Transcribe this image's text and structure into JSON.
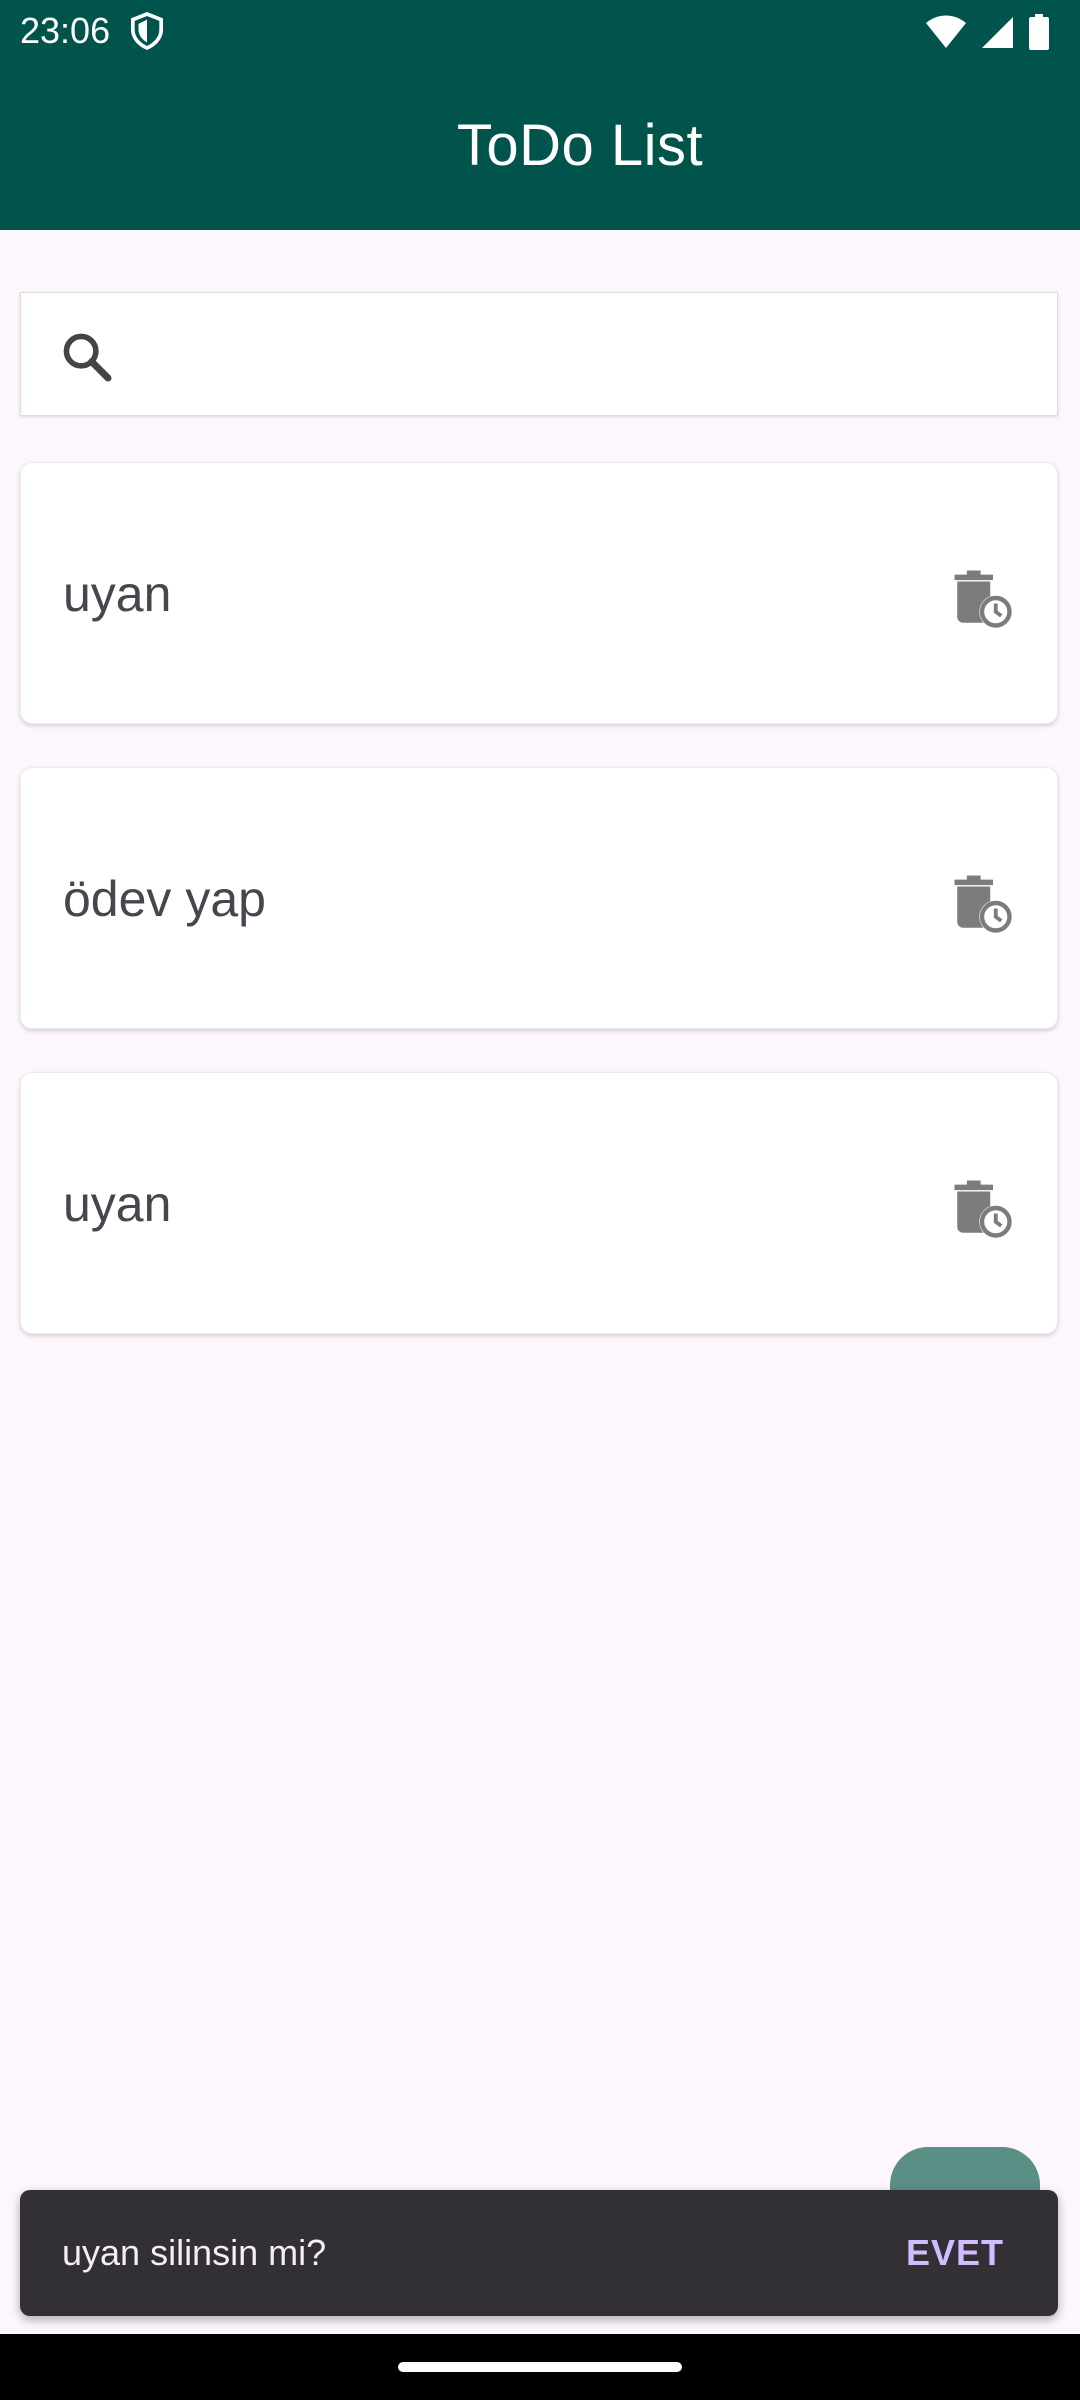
{
  "status_bar": {
    "time": "23:06",
    "icons": [
      "shield-icon",
      "wifi-icon",
      "signal-icon",
      "battery-icon"
    ]
  },
  "app_bar": {
    "title": "ToDo List",
    "color": "#00544b"
  },
  "search": {
    "icon": "search-icon",
    "value": "",
    "placeholder": ""
  },
  "todos": [
    {
      "title": "uyan",
      "icon": "delete-clock-icon"
    },
    {
      "title": "ödev yap",
      "icon": "delete-clock-icon"
    },
    {
      "title": "uyan",
      "icon": "delete-clock-icon"
    }
  ],
  "fab": {
    "color": "#5a8f85"
  },
  "snackbar": {
    "message": "uyan silinsin mi?",
    "action": "EVET",
    "action_color": "#d0bcff"
  }
}
